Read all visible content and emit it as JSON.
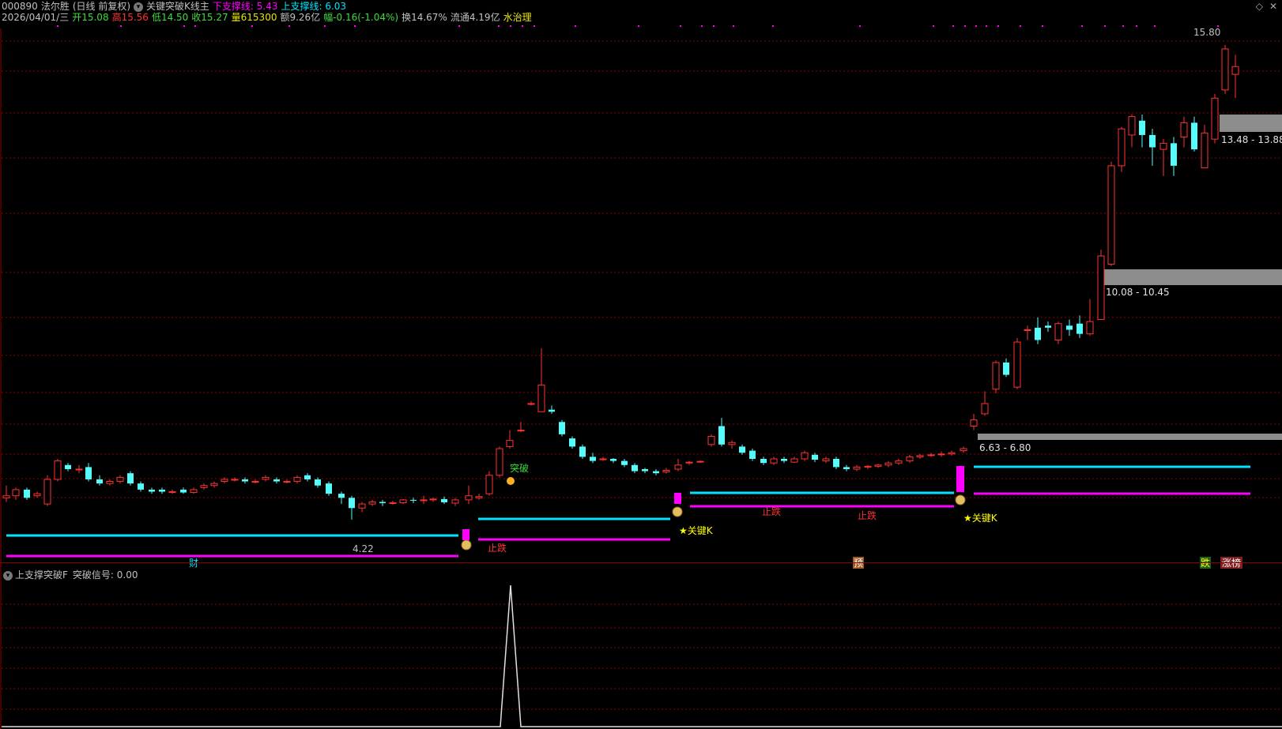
{
  "header": {
    "code": "000890",
    "name": "法尔胜",
    "period": "(日线 前复权)",
    "indicator": "关键突破K线主",
    "lower_label": "下支撑线: 5.43",
    "upper_label": "上支撑线: 6.03",
    "date": "2026/04/01/三",
    "open": "开15.08",
    "high": "高15.56",
    "low": "低14.50",
    "close": "收15.27",
    "volume": "量615300",
    "amount": "额9.26亿",
    "change": "幅-0.16(-1.04%)",
    "turnover": "换14.67%",
    "float": "流通4.19亿",
    "concept": "水治理"
  },
  "price_labels": {
    "high_mark": "15.80",
    "low_mark": "4.22",
    "zone1": "6.63 - 6.80",
    "zone2": "10.08 - 10.45",
    "zone3": "13.48 - 13.88"
  },
  "signals": {
    "breakout": "突破",
    "key_k_1": "★关键K",
    "key_k_2": "★关键K",
    "stop_fall_1": "止跌",
    "stop_fall_2": "止跌",
    "stop_fall_3": "止跌"
  },
  "bottom_tags": {
    "cai": "财",
    "yu": "预",
    "die": "跌",
    "zhangbang": "涨榜"
  },
  "indicator_panel": {
    "title": "上支撑突破F",
    "signal_label": "突破信号: 0.00"
  },
  "colors": {
    "up": "#ff3232",
    "down": "#54fcfc",
    "upper_line": "#00e5ff",
    "lower_line": "#ff00ff",
    "grid": "#8a0000",
    "zone": "#8c8c8c"
  }
}
